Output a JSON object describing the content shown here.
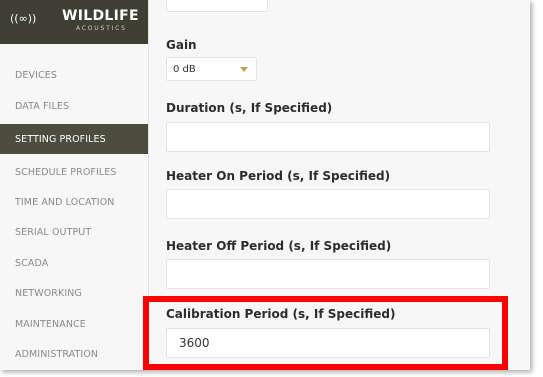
{
  "logo": {
    "mark": "((∞))",
    "word": "WILDLIFE",
    "sub": "ACOUSTICS"
  },
  "sidebar": {
    "items": [
      {
        "label": "DEVICES",
        "active": false
      },
      {
        "label": "DATA FILES",
        "active": false
      },
      {
        "label": "SETTING PROFILES",
        "active": true
      },
      {
        "label": "SCHEDULE PROFILES",
        "active": false
      },
      {
        "label": "TIME AND LOCATION",
        "active": false
      },
      {
        "label": "SERIAL OUTPUT",
        "active": false
      },
      {
        "label": "SCADA",
        "active": false
      },
      {
        "label": "NETWORKING",
        "active": false
      },
      {
        "label": "MAINTENANCE",
        "active": false
      },
      {
        "label": "ADMINISTRATION",
        "active": false
      }
    ]
  },
  "form": {
    "gain_label": "Gain",
    "gain_value": "0 dB",
    "duration_label": "Duration (s, If Specified)",
    "duration_value": "",
    "heater_on_label": "Heater On Period (s, If Specified)",
    "heater_on_value": "",
    "heater_off_label": "Heater Off Period (s, If Specified)",
    "heater_off_value": "",
    "calibration_label": "Calibration Period (s, If Specified)",
    "calibration_value": "3600"
  },
  "colors": {
    "header_bg": "#3f3f33",
    "active_nav_bg": "#4c4c3f",
    "caret": "#c79a52",
    "highlight": "#ff0000"
  }
}
